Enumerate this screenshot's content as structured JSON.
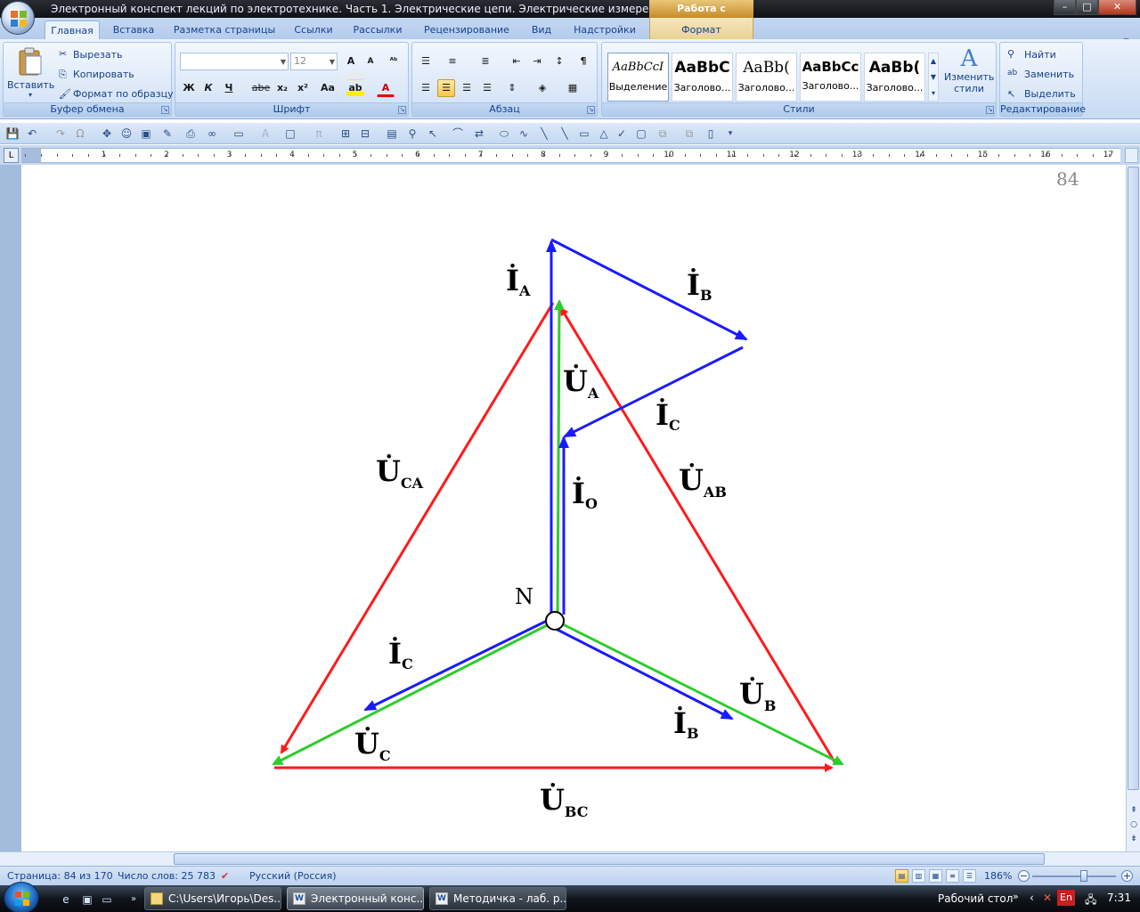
{
  "window": {
    "title": "Электронный конспект лекций по электротехнике. Часть 1. Электрические цепи. Электрические измерения - Micros...",
    "context_tab": "Работа с рисунками",
    "controls": {
      "minimize": "–",
      "maximize": "□",
      "close": "✕"
    }
  },
  "ribbon_tabs": [
    "Главная",
    "Вставка",
    "Разметка страницы",
    "Ссылки",
    "Рассылки",
    "Рецензирование",
    "Вид",
    "Надстройки",
    "Формат"
  ],
  "clipboard": {
    "paste": "Вставить",
    "cut": "Вырезать",
    "copy": "Копировать",
    "format_painter": "Формат по образцу",
    "label": "Буфер обмена"
  },
  "font": {
    "name_value": "",
    "size_value": "12",
    "label": "Шрифт",
    "bold": "Ж",
    "italic": "К",
    "underline": "Ч",
    "strike": "abe",
    "subscript": "x₂",
    "superscript": "x²",
    "case": "Aa",
    "grow": "A",
    "shrink": "A"
  },
  "paragraph": {
    "label": "Абзац",
    "pilcrow": "¶"
  },
  "styles": {
    "label": "Стили",
    "tiles": [
      {
        "sample": "AaBbCcI",
        "name": "Выделение"
      },
      {
        "sample": "AaBbC",
        "name": "Заголово..."
      },
      {
        "sample": "AaBb(",
        "name": "Заголово..."
      },
      {
        "sample": "AaBbCc",
        "name": "Заголово..."
      },
      {
        "sample": "AaBb(",
        "name": "Заголово..."
      }
    ],
    "change_styles": [
      "Изменить",
      "стили"
    ]
  },
  "editing": {
    "label": "Редактирование",
    "find": "Найти",
    "replace": "Заменить",
    "select": "Выделить"
  },
  "ruler": {
    "corner": "L",
    "numbers": [
      "1",
      "2",
      "1",
      "2",
      "3",
      "4",
      "5",
      "6",
      "7",
      "8",
      "9",
      "10",
      "11",
      "12",
      "13",
      "14",
      "15",
      "16",
      "17"
    ]
  },
  "page": {
    "number": "84"
  },
  "chart_data": {
    "type": "phasor-diagram",
    "node_label": "N",
    "current_labels": [
      {
        "main": "İ",
        "sub": "A"
      },
      {
        "main": "İ",
        "sub": "B"
      },
      {
        "main": "İ",
        "sub": "C"
      },
      {
        "main": "İ",
        "sub": "O"
      },
      {
        "main": "İ",
        "sub": "C"
      },
      {
        "main": "İ",
        "sub": "B"
      }
    ],
    "voltage_labels": [
      {
        "main": "U̇",
        "sub": "A"
      },
      {
        "main": "U̇",
        "sub": "CA"
      },
      {
        "main": "U̇",
        "sub": "AB"
      },
      {
        "main": "U̇",
        "sub": "B"
      },
      {
        "main": "U̇",
        "sub": "C"
      },
      {
        "main": "U̇",
        "sub": "BC"
      }
    ],
    "colors": {
      "phase_voltage": "#2ecc2e",
      "line_voltage": "#ff1a1a",
      "current": "#1a1aff"
    }
  },
  "status": {
    "page": "Страница: 84 из 170",
    "words": "Число слов: 25 783",
    "language": "Русский (Россия)",
    "zoom": "186%"
  },
  "taskbar": {
    "items": [
      {
        "label": "C:\\Users\\Игорь\\Des...",
        "icon": "folder-icon"
      },
      {
        "label": "Электронный конс...",
        "icon": "word-icon"
      },
      {
        "label": "Методичка - лаб. р...",
        "icon": "word-icon"
      }
    ],
    "desktop": "Рабочий стол",
    "lang": "En",
    "clock": "7:31"
  }
}
